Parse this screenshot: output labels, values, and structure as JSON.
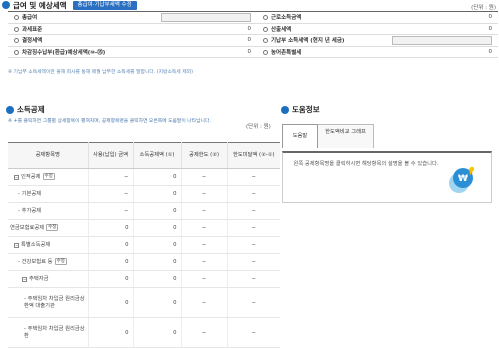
{
  "header": {
    "title": "급여 및 예상세액",
    "btn": "총급여·기납부세액 수정",
    "unit": "(단위 : 원)"
  },
  "summary": {
    "rows": [
      {
        "left": "총급여",
        "lval": "",
        "right": "근로소득금액",
        "rval": "0"
      },
      {
        "left": "과세표준",
        "lval": "0",
        "right": "산출세액",
        "rval": "0"
      },
      {
        "left": "결정세액",
        "lval": "0",
        "right": "기납부 소득세액 (현지 년 세금)",
        "rval": ""
      },
      {
        "left": "차감징수납부(환급)예상세액(⑩-⑮)",
        "lval": "0",
        "right": "농어촌특별세",
        "rval": "0"
      }
    ],
    "note": "※ 기납부 소득세액이란 올해 회사를 통해 매월 납부한 소득세를 말합니다. (지방소득세 제외)"
  },
  "deduction": {
    "title": "소득공제",
    "note": "※ +를 클릭하면 그룹별 상세항목이 펼쳐지며, 공제항목명을 클릭하면 오른쪽에 도움말이 나타납니다.",
    "unit": "(단위 : 원)",
    "headers": [
      "공제항목명",
      "사용(납입) 금액",
      "소득공제액 (①)",
      "공제한도 (②)",
      "한도미달액 (②-①)"
    ],
    "button": "수정",
    "rows": [
      {
        "name": "인적공제",
        "toggle": "−",
        "btn": true,
        "v": [
          "−",
          "0",
          "−",
          "−"
        ]
      },
      {
        "name": "- 기본공제",
        "toggle": "",
        "btn": false,
        "v": [
          "−",
          "0",
          "−",
          "−"
        ]
      },
      {
        "name": "- 추가공제",
        "toggle": "",
        "btn": false,
        "v": [
          "−",
          "0",
          "−",
          "−"
        ]
      },
      {
        "name": "연금보험료공제",
        "toggle": "",
        "btn": true,
        "v": [
          "0",
          "0",
          "−",
          "−"
        ]
      },
      {
        "name": "특별소득공제",
        "toggle": "−",
        "btn": false,
        "v": [
          "0",
          "0",
          "−",
          "−"
        ]
      },
      {
        "name": "- 건강보험료 등",
        "toggle": "",
        "btn": true,
        "v": [
          "0",
          "0",
          "−",
          "−"
        ]
      },
      {
        "name": "주택자금",
        "toggle": "−",
        "btn": false,
        "v": [
          "0",
          "0",
          "−",
          "−"
        ]
      },
      {
        "name": "- 주택임차 차입금 원리금상환액 대출기관",
        "toggle": "",
        "btn": false,
        "v": [
          "0",
          "0",
          "−",
          "−"
        ]
      },
      {
        "name": "- 주택임차 차입금 원리금상환",
        "toggle": "",
        "btn": false,
        "v": [
          "0",
          "0",
          "−",
          "−"
        ]
      }
    ]
  },
  "help": {
    "title": "도움정보",
    "tabs": [
      "도움말",
      "한도액비교 그래프"
    ],
    "text": "왼쪽 공제항목명을 클릭하시면 해당항목의 설명을 볼 수 있습니다."
  }
}
